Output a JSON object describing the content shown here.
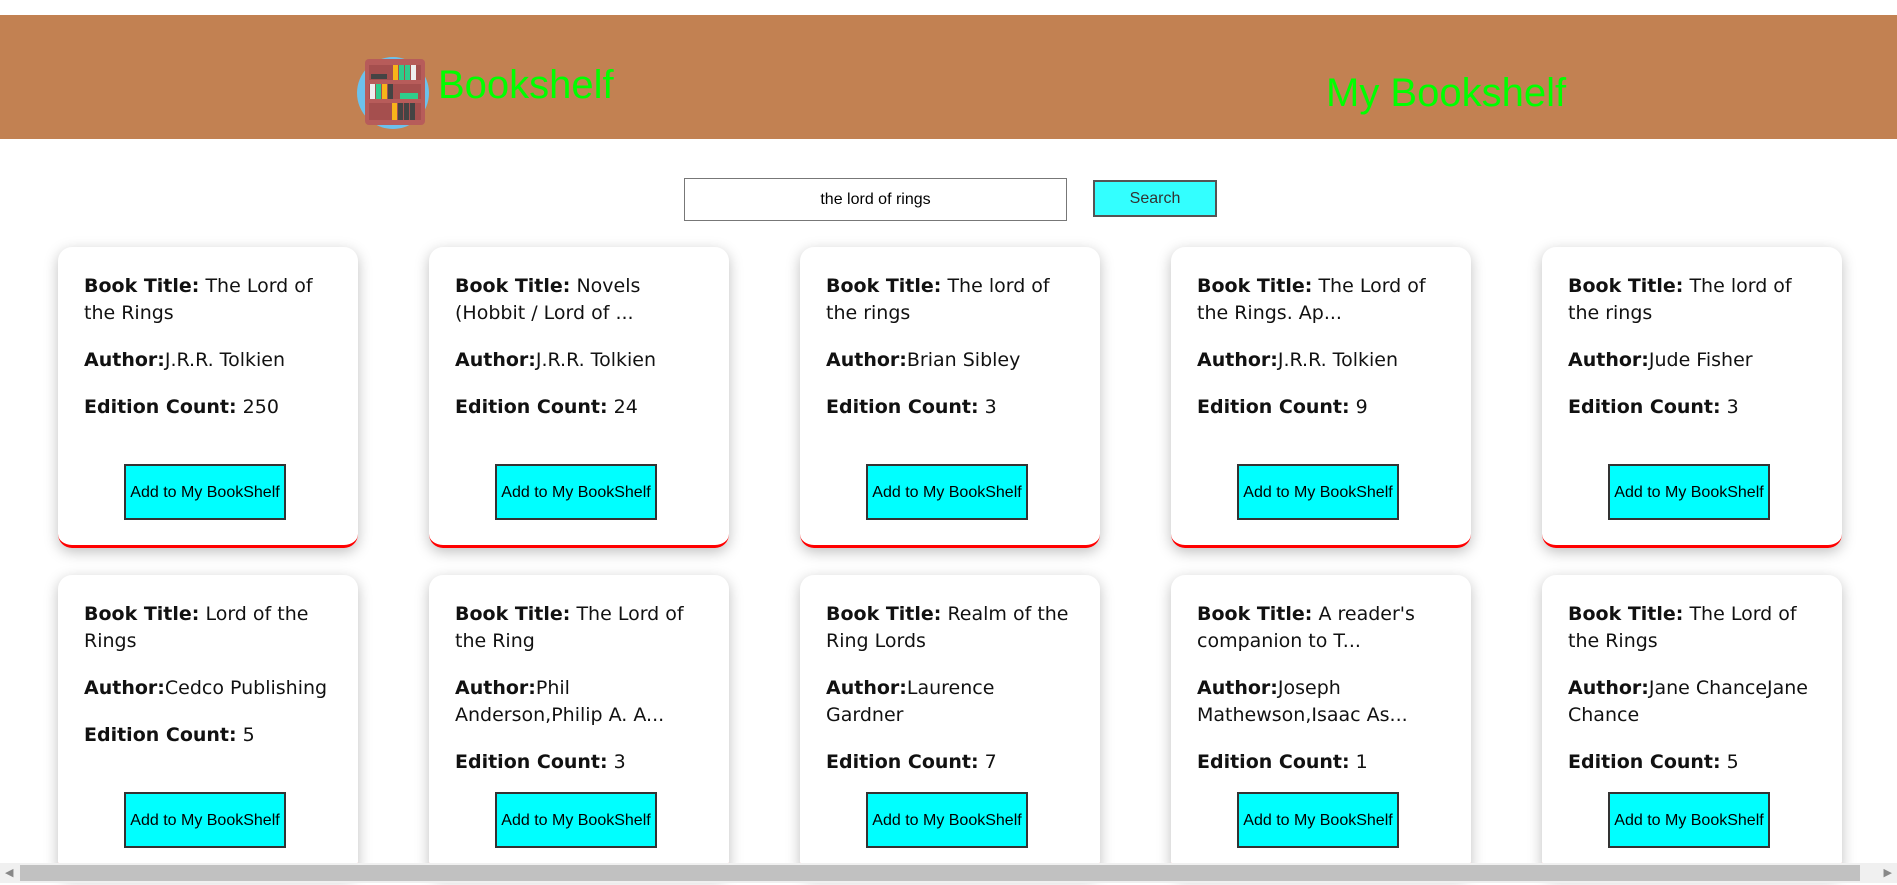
{
  "header": {
    "brand": "Bookshelf",
    "title": "My Bookshelf",
    "logo": "bookshelf-logo"
  },
  "search": {
    "value": "the lord of rings",
    "button": "Search"
  },
  "labels": {
    "title": "Book Title:",
    "author": "Author:",
    "edition": "Edition Count:",
    "add": "Add to My BookShelf"
  },
  "books": [
    {
      "title": "The Lord of the Rings",
      "author": "J.R.R. Tolkien",
      "edition": "250"
    },
    {
      "title": "Novels (Hobbit / Lord of ...",
      "author": "J.R.R. Tolkien",
      "edition": "24"
    },
    {
      "title": "The lord of the rings",
      "author": "Brian Sibley",
      "edition": "3"
    },
    {
      "title": "The Lord of the Rings. Ap...",
      "author": "J.R.R. Tolkien",
      "edition": "9"
    },
    {
      "title": "The lord of the rings",
      "author": "Jude Fisher",
      "edition": "3"
    },
    {
      "title": "Lord of the Rings",
      "author": "Cedco Publishing",
      "edition": "5"
    },
    {
      "title": "The Lord of the Ring",
      "author": "Phil Anderson,Philip A. A...",
      "edition": "3"
    },
    {
      "title": "Realm of the Ring Lords",
      "author": "Laurence Gardner",
      "edition": "7"
    },
    {
      "title": "A reader's companion to T...",
      "author": "Joseph Mathewson,Isaac As...",
      "edition": "1"
    },
    {
      "title": "The Lord of the Rings",
      "author": "Jane ChanceJane Chance",
      "edition": "5"
    }
  ],
  "colors": {
    "header": "#c28152",
    "brand": "#00ff00",
    "button": "#00ffff",
    "accent": "#ff0000"
  }
}
